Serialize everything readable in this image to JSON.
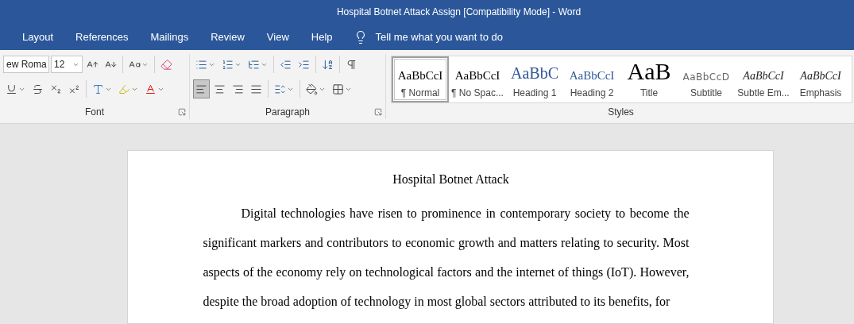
{
  "window": {
    "title": "Hospital Botnet Attack Assign [Compatibility Mode]  -  Word"
  },
  "menu_tabs": [
    {
      "label": "Layout",
      "selected": false
    },
    {
      "label": "References",
      "selected": false
    },
    {
      "label": "Mailings",
      "selected": false
    },
    {
      "label": "Review",
      "selected": false
    },
    {
      "label": "View",
      "selected": false
    },
    {
      "label": "Help",
      "selected": false
    }
  ],
  "tell_me": "Tell me what you want to do",
  "font_group": {
    "label": "Font",
    "font_name": "ew Roma",
    "font_size": "12"
  },
  "paragraph_group": {
    "label": "Paragraph",
    "align_buttons": [
      {
        "selected": true
      },
      {
        "selected": false
      },
      {
        "selected": false
      },
      {
        "selected": false
      }
    ]
  },
  "styles_group": {
    "label": "Styles",
    "items": [
      {
        "sample": "AaBbCcI",
        "name": "¶ Normal",
        "kind": "normal",
        "selected": true
      },
      {
        "sample": "AaBbCcI",
        "name": "¶ No Spac...",
        "kind": "normal",
        "selected": false
      },
      {
        "sample": "AaBbC",
        "name": "Heading 1",
        "kind": "heading1",
        "selected": false
      },
      {
        "sample": "AaBbCcI",
        "name": "Heading 2",
        "kind": "heading2",
        "selected": false
      },
      {
        "sample": "AaB",
        "name": "Title",
        "kind": "title",
        "selected": false
      },
      {
        "sample": "AaBbCcD",
        "name": "Subtitle",
        "kind": "subtitle",
        "selected": false
      },
      {
        "sample": "AaBbCcI",
        "name": "Subtle Em...",
        "kind": "emphasis",
        "selected": false
      },
      {
        "sample": "AaBbCcI",
        "name": "Emphasis",
        "kind": "emphasis",
        "selected": false
      }
    ]
  },
  "document": {
    "title": "Hospital Botnet Attack",
    "paragraphs": [
      "Digital technologies have risen to prominence in contemporary society to become the significant markers and contributors to economic growth and matters relating to security. Most aspects of the economy rely on technological factors and the internet of things (IoT). However, despite the broad adoption of technology in most global sectors attributed to its benefits, for"
    ]
  }
}
